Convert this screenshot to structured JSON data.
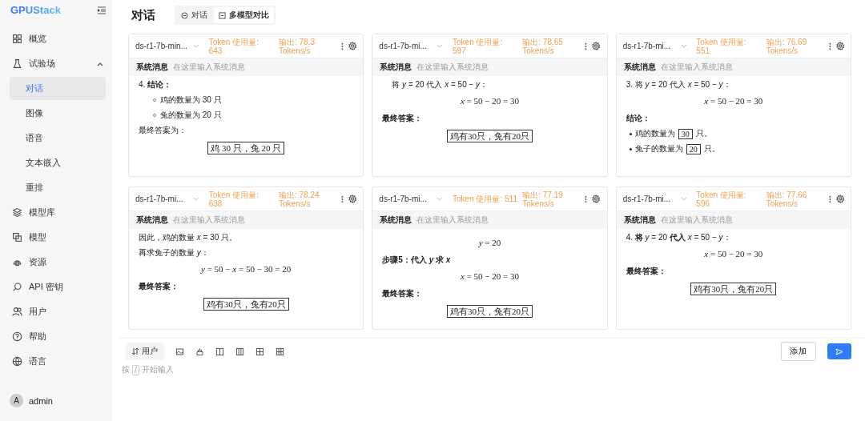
{
  "sidebar": {
    "logo": "GPUStack",
    "items": [
      {
        "label": "概览",
        "selected": false
      },
      {
        "label": "试验场",
        "selected": false,
        "expanded": true,
        "children": [
          {
            "label": "对话",
            "selected": true
          },
          {
            "label": "图像",
            "selected": false
          },
          {
            "label": "语音",
            "selected": false
          },
          {
            "label": "文本嵌入",
            "selected": false
          },
          {
            "label": "重排",
            "selected": false
          }
        ]
      },
      {
        "label": "模型库",
        "selected": false
      },
      {
        "label": "模型",
        "selected": false
      },
      {
        "label": "资源",
        "selected": false
      },
      {
        "label": "API 密钥",
        "selected": false
      },
      {
        "label": "用户",
        "selected": false
      },
      {
        "label": "帮助",
        "selected": false
      },
      {
        "label": "语言",
        "selected": false
      }
    ],
    "user": {
      "avatar": "A",
      "name": "admin"
    }
  },
  "page": {
    "title": "对话",
    "tabs": [
      {
        "label": "对话",
        "selected": false
      },
      {
        "label": "多模型对比",
        "selected": true
      }
    ]
  },
  "panels": [
    {
      "model": "ds-r1-7b-min...",
      "tokens": "Token 使用量: 643",
      "speed": "输出: 78.3 Tokens/s",
      "system_label": "系统消息",
      "system_placeholder": "在这里输入系统消息",
      "lines": [
        {
          "kind": "text",
          "text": "4. **结论：**"
        },
        {
          "kind": "circle",
          "text": "鸡的数量为 30 只"
        },
        {
          "kind": "circle",
          "text": "兔的数量为 20 只"
        },
        {
          "kind": "text",
          "text": "最终答案为："
        },
        {
          "kind": "answer",
          "text": "鸡 30 只，兔 20 只"
        }
      ]
    },
    {
      "model": "ds-r1-7b-mi...",
      "tokens": "Token 使用量: 597",
      "speed": "输出: 78.65 Tokens/s",
      "system_label": "系统消息",
      "system_placeholder": "在这里输入系统消息",
      "lines": [
        {
          "kind": "indent",
          "text": "将 *y* = 20 代入 *x* = 50 − *y*："
        },
        {
          "kind": "math",
          "text": "*x* = 50 − 20 = 30"
        },
        {
          "kind": "heading",
          "text": "最终答案："
        },
        {
          "kind": "answer",
          "text": "鸡有30只，兔有20只"
        }
      ]
    },
    {
      "model": "ds-r1-7b-mi...",
      "tokens": "Token 使用量: 551",
      "speed": "输出: 76.69 Tokens/s",
      "system_label": "系统消息",
      "system_placeholder": "在这里输入系统消息",
      "lines": [
        {
          "kind": "text",
          "text": "3. 将 *y* = 20 代入 *x* = 50 − *y*："
        },
        {
          "kind": "math",
          "text": "*x* = 50 − 20 = 30"
        },
        {
          "kind": "heading",
          "text": "结论："
        },
        {
          "kind": "boxed-bullet",
          "before": "鸡的数量为",
          "boxed": "30",
          "after": "只。"
        },
        {
          "kind": "boxed-bullet",
          "before": "兔子的数量为",
          "boxed": "20",
          "after": "只。"
        }
      ]
    },
    {
      "model": "ds-r1-7b-mi...",
      "tokens": "Token 使用量: 638",
      "speed": "输出: 78.24 Tokens/s",
      "system_label": "系统消息",
      "system_placeholder": "在这里输入系统消息",
      "lines": [
        {
          "kind": "text",
          "text": "因此，鸡的数量 *x* = 30 只。"
        },
        {
          "kind": "text",
          "text": "再求兔子的数量 *y*："
        },
        {
          "kind": "math",
          "text": "*y* = 50 − *x* = 50 − 30 = 20"
        },
        {
          "kind": "heading",
          "text": "最终答案："
        },
        {
          "kind": "answer",
          "text": "鸡有30只，兔有20只"
        }
      ]
    },
    {
      "model": "ds-r1-7b-mi...",
      "tokens": "Token 使用量: 511",
      "speed": "输出: 77.19 Tokens/s",
      "system_label": "系统消息",
      "system_placeholder": "在这里输入系统消息",
      "lines": [
        {
          "kind": "math",
          "text": "*y* = 20"
        },
        {
          "kind": "heading",
          "text": "步骤5：代入 *y* 求 *x*"
        },
        {
          "kind": "math",
          "text": "*x* = 50 − 20 = 30"
        },
        {
          "kind": "heading",
          "text": "最终答案："
        },
        {
          "kind": "answer",
          "text": "鸡有30只，兔有20只"
        }
      ]
    },
    {
      "model": "ds-r1-7b-mi...",
      "tokens": "Token 使用量: 596",
      "speed": "输出: 77.66 Tokens/s",
      "system_label": "系统消息",
      "system_placeholder": "在这里输入系统消息",
      "lines": [
        {
          "kind": "text",
          "text": "4. **将** *y* = 20 **代入** *x* = 50 − *y*："
        },
        {
          "kind": "math",
          "text": "*x* = 50 − 20 = 30"
        },
        {
          "kind": "heading",
          "text": "最终答案："
        },
        {
          "kind": "answer",
          "text": "鸡有30只，兔有20只"
        }
      ]
    }
  ],
  "composer": {
    "role": "用户",
    "add": "添加",
    "hint_before": "按",
    "hint_key": "/",
    "hint_after": "开始输入"
  }
}
